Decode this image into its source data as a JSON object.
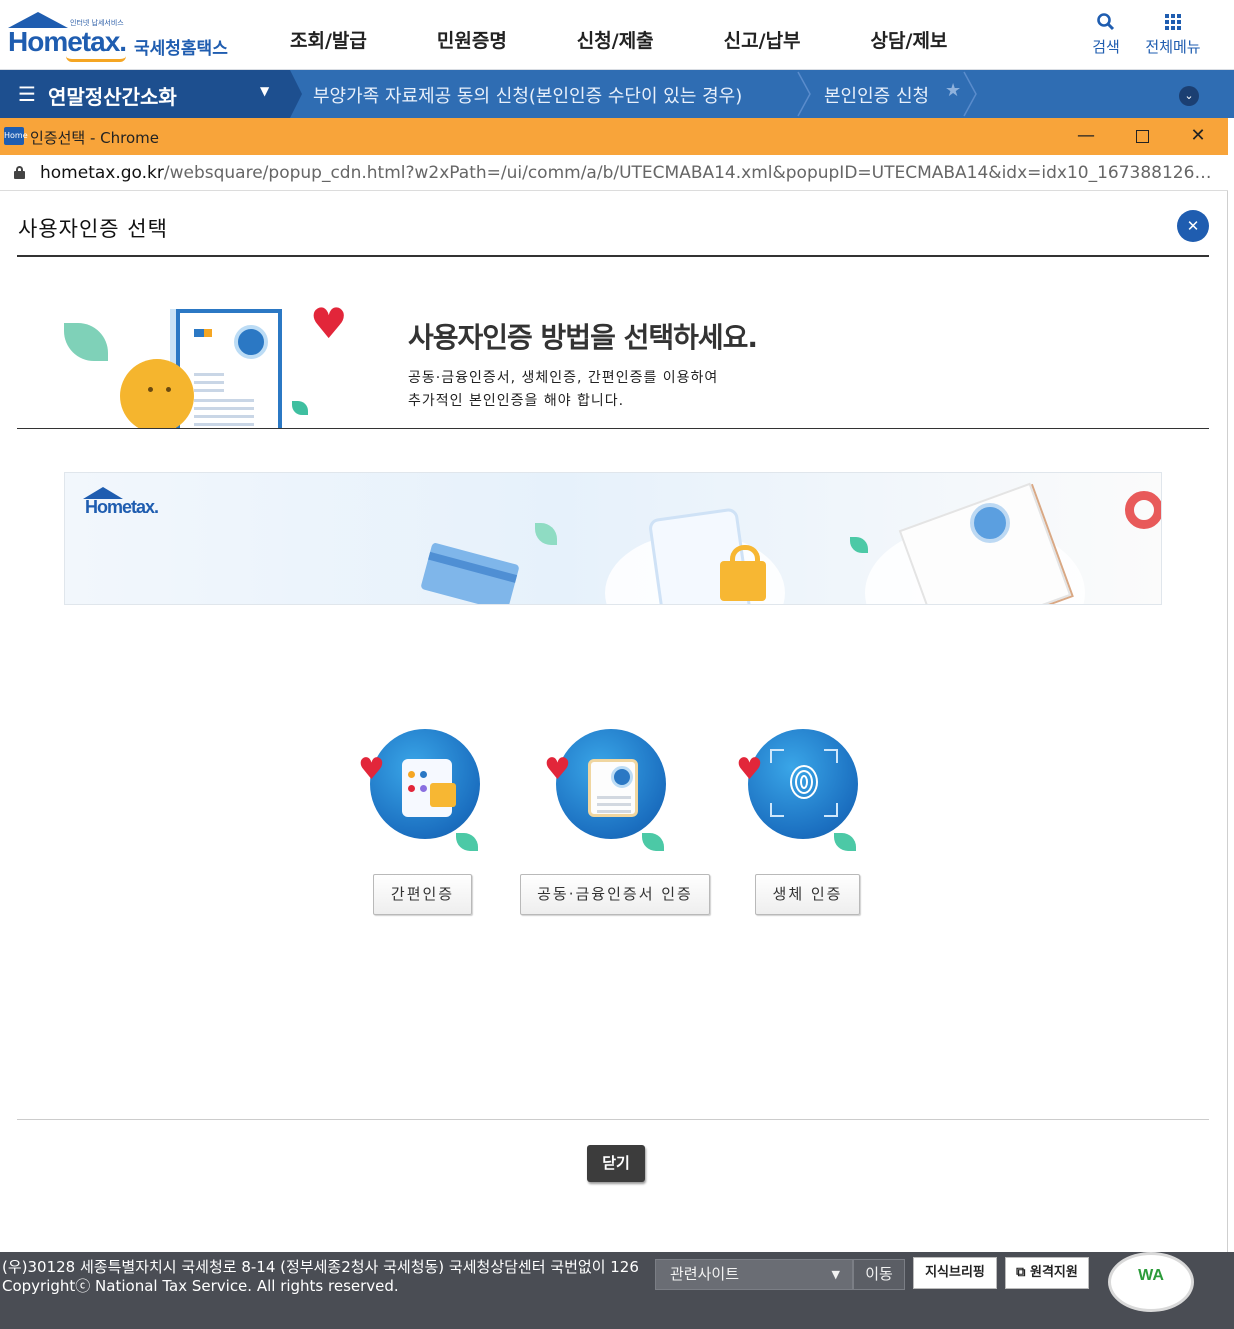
{
  "site": {
    "logo_tagline": "인터넷 납세서비스",
    "logo_main": "Hometax.",
    "logo_kor": "국세청홈택스",
    "nav": [
      "조회/발급",
      "민원증명",
      "신청/제출",
      "신고/납부",
      "상담/제보"
    ],
    "search_label": "검색",
    "allmenu_label": "전체메뉴"
  },
  "breadcrumb": {
    "menu": "연말정산간소화",
    "items": [
      "부양가족 자료제공 동의 신청(본인인증 수단이 있는 경우)",
      "본인인증 신청"
    ]
  },
  "window": {
    "app_icon_text": "Home",
    "title": "인증선택 - Chrome",
    "url_host": "hometax.go.kr",
    "url_path": "/websquare/popup_cdn.html?w2xPath=/ui/comm/a/b/UTECMABA14.xml&popupID=UTECMABA14&idx=idx10_16738812631062031..."
  },
  "popup": {
    "title": "사용자인증 선택",
    "heading": "사용자인증 방법을 선택하세요.",
    "desc_line1": "공동·금융인증서, 생체인증, 간편인증를 이용하여",
    "desc_line2": "추가적인 본인인증을 해야 합니다.",
    "banner_logo": "Hometax.",
    "methods": [
      {
        "label": "간편인증",
        "icon": "phone-lock-icon"
      },
      {
        "label": "공동·금융인증서 인증",
        "icon": "certificate-icon"
      },
      {
        "label": "생체 인증",
        "icon": "fingerprint-icon"
      }
    ],
    "close_label": "닫기"
  },
  "footer": {
    "address": "(우)30128 세종특별자치시 국세청로 8-14 (정부세종2청사 국세청동) 국세청상담센터 국번없이 126",
    "copyright": "Copyrightⓒ National Tax Service. All rights reserved.",
    "related_select": "관련사이트",
    "go_label": "이동",
    "policy_btn": "지식브리핑",
    "remote_btn": "원격지원",
    "wa_mark": "WA"
  },
  "colors": {
    "brand_blue": "#1f5db0",
    "crumb_bar": "#2f6db3",
    "popup_titlebar": "#f8a43a",
    "footer_bg": "#4a4d54"
  }
}
